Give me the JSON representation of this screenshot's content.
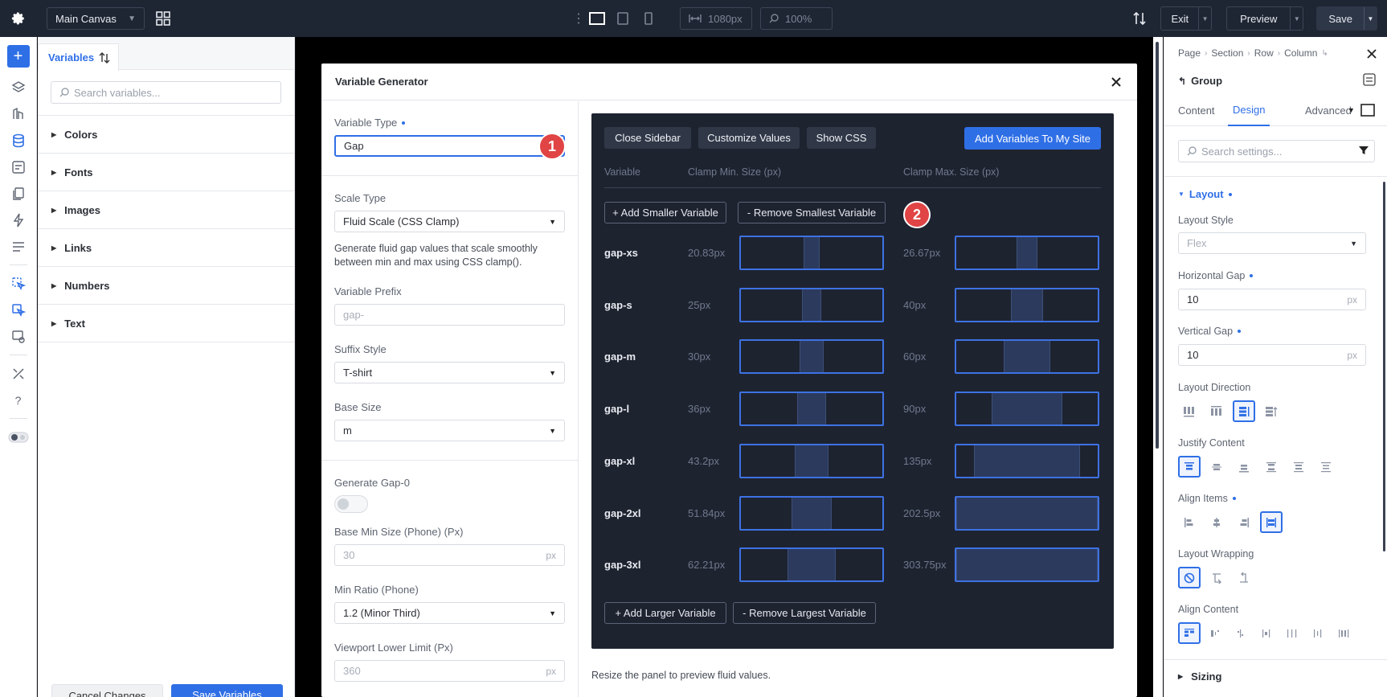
{
  "topbar": {
    "canvas_select": "Main Canvas",
    "width_value": "1080px",
    "zoom_value": "100%",
    "exit_label": "Exit",
    "preview_label": "Preview",
    "save_label": "Save"
  },
  "variables_panel": {
    "tab_label": "Variables",
    "search_placeholder": "Search variables...",
    "groups": [
      "Colors",
      "Fonts",
      "Images",
      "Links",
      "Numbers",
      "Text"
    ],
    "cancel_label": "Cancel Changes",
    "save_label": "Save Variables"
  },
  "modal": {
    "title": "Variable Generator",
    "variable_type_label": "Variable Type",
    "variable_type_value": "Gap",
    "scale_type_label": "Scale Type",
    "scale_type_value": "Fluid Scale (CSS Clamp)",
    "scale_help": "Generate fluid gap values that scale smoothly between min and max using CSS clamp().",
    "prefix_label": "Variable Prefix",
    "prefix_placeholder": "gap-",
    "suffix_label": "Suffix Style",
    "suffix_value": "T-shirt",
    "base_size_label": "Base Size",
    "base_size_value": "m",
    "gap0_label": "Generate Gap-0",
    "base_min_label": "Base Min Size (Phone) (Px)",
    "base_min_placeholder": "30",
    "min_ratio_label": "Min Ratio (Phone)",
    "min_ratio_value": "1.2 (Minor Third)",
    "viewport_lower_label": "Viewport Lower Limit (Px)",
    "viewport_lower_placeholder": "360",
    "unit_px": "px",
    "badge1": "1",
    "badge2": "2",
    "resize_note": "Resize the panel to preview fluid values."
  },
  "preview": {
    "close_sidebar": "Close Sidebar",
    "customize_values": "Customize Values",
    "show_css": "Show CSS",
    "add_variables": "Add Variables To My Site",
    "col_variable": "Variable",
    "col_min": "Clamp Min. Size (px)",
    "col_max": "Clamp Max. Size (px)",
    "add_smaller": "+ Add Smaller Variable",
    "remove_smallest": "- Remove Smallest Variable",
    "add_larger": "+ Add Larger Variable",
    "remove_largest": "- Remove Largest Variable",
    "rows": [
      {
        "name": "gap-xs",
        "min": "20.83px",
        "max": "26.67px",
        "min_frac": 0.116,
        "max_frac": 0.148
      },
      {
        "name": "gap-s",
        "min": "25px",
        "max": "40px",
        "min_frac": 0.139,
        "max_frac": 0.222
      },
      {
        "name": "gap-m",
        "min": "30px",
        "max": "60px",
        "min_frac": 0.167,
        "max_frac": 0.333
      },
      {
        "name": "gap-l",
        "min": "36px",
        "max": "90px",
        "min_frac": 0.2,
        "max_frac": 0.5
      },
      {
        "name": "gap-xl",
        "min": "43.2px",
        "max": "135px",
        "min_frac": 0.24,
        "max_frac": 0.75
      },
      {
        "name": "gap-2xl",
        "min": "51.84px",
        "max": "202.5px",
        "min_frac": 0.288,
        "max_frac": 1
      },
      {
        "name": "gap-3xl",
        "min": "62.21px",
        "max": "303.75px",
        "min_frac": 0.346,
        "max_frac": 1
      }
    ]
  },
  "settings": {
    "breadcrumb": [
      "Page",
      "Section",
      "Row",
      "Column"
    ],
    "group_label": "Group",
    "tabs": [
      "Content",
      "Design",
      "Advanced"
    ],
    "search_placeholder": "Search settings...",
    "layout_section": "Layout",
    "layout_style_label": "Layout Style",
    "layout_style_value": "Flex",
    "hgap_label": "Horizontal Gap",
    "hgap_value": "10",
    "vgap_label": "Vertical Gap",
    "vgap_value": "10",
    "unit_px": "px",
    "direction_label": "Layout Direction",
    "justify_label": "Justify Content",
    "align_items_label": "Align Items",
    "wrapping_label": "Layout Wrapping",
    "align_content_label": "Align Content",
    "sizing_label": "Sizing"
  },
  "colors": {
    "accent": "#2f6fe6",
    "topbar": "#1f2633",
    "preview_bg": "#1e2330",
    "badge": "#e04444"
  }
}
